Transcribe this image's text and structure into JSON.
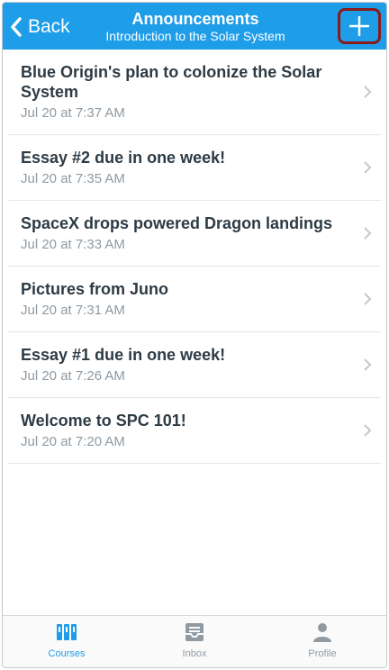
{
  "navbar": {
    "back_label": "Back",
    "title": "Announcements",
    "subtitle": "Introduction to the Solar System",
    "add_icon": "plus-icon",
    "color": "#1e9de8"
  },
  "announcements": [
    {
      "title": "Blue Origin's plan to colonize the Solar System",
      "date": "Jul 20 at 7:37 AM"
    },
    {
      "title": "Essay #2 due in one week!",
      "date": "Jul 20 at 7:35 AM"
    },
    {
      "title": "SpaceX drops powered Dragon landings",
      "date": "Jul 20 at 7:33 AM"
    },
    {
      "title": "Pictures from Juno",
      "date": "Jul 20 at 7:31 AM"
    },
    {
      "title": "Essay #1 due in one week!",
      "date": "Jul 20 at 7:26 AM"
    },
    {
      "title": "Welcome to SPC 101!",
      "date": "Jul 20 at 7:20 AM"
    }
  ],
  "tabbar": {
    "tabs": [
      {
        "label": "Courses",
        "icon": "courses-icon",
        "active": true
      },
      {
        "label": "Inbox",
        "icon": "inbox-icon",
        "active": false
      },
      {
        "label": "Profile",
        "icon": "profile-icon",
        "active": false
      }
    ]
  }
}
